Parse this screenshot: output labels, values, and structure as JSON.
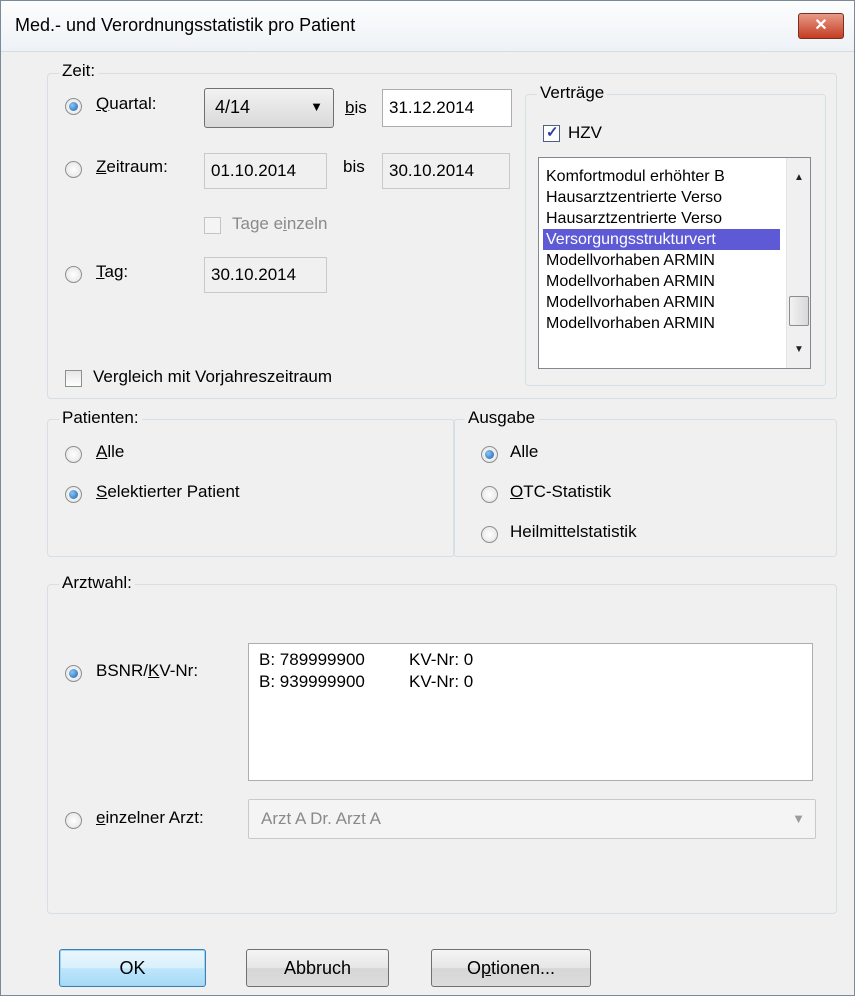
{
  "window": {
    "title": "Med.- und Verordnungsstatistik pro Patient",
    "close_glyph": "✕"
  },
  "zeit": {
    "legend": "Zeit:",
    "quartal": {
      "label": "Quartal:",
      "accel": "Q",
      "label_rest": "uartal:",
      "selected": true,
      "value": "4/14",
      "bis_label_accel": "b",
      "bis_label_rest": "is",
      "bis_value": "31.12.2014"
    },
    "zeitraum": {
      "accel": "Z",
      "label_rest": "eitraum:",
      "selected": false,
      "from": "01.10.2014",
      "bis_label": "bis",
      "to": "30.10.2014"
    },
    "tage_einzeln": {
      "label_pre": "Tage e",
      "accel": "i",
      "label_post": "nzeln",
      "checked": false,
      "enabled": false
    },
    "tag": {
      "accel": "T",
      "label_rest": "ag:",
      "selected": false,
      "value": "30.10.2014"
    },
    "vergleich": {
      "label": "Vergleich mit Vorjahreszeitraum",
      "checked": false
    }
  },
  "vertraege": {
    "legend": "Verträge",
    "hzv": {
      "label": "HZV",
      "checked": true
    },
    "items": [
      "Komfortmodul erhöhter B",
      "Hausarztzentrierte Verso",
      "Hausarztzentrierte Verso",
      "Versorgungsstrukturvert",
      "Modellvorhaben ARMIN",
      "Modellvorhaben ARMIN",
      "Modellvorhaben ARMIN",
      "Modellvorhaben ARMIN"
    ],
    "selected_index": 3
  },
  "patienten": {
    "legend": "Patienten:",
    "alle": {
      "accel": "A",
      "label_rest": "lle",
      "selected": false
    },
    "selektierter": {
      "accel": "S",
      "label_rest": "elektierter Patient",
      "selected": true
    }
  },
  "ausgabe": {
    "legend": "Ausgabe",
    "alle": {
      "label": "Alle",
      "selected": true
    },
    "otc": {
      "accel": "O",
      "label_rest": "TC-Statistik",
      "selected": false
    },
    "heilmittel": {
      "label": "Heilmittelstatistik",
      "selected": false
    }
  },
  "arztwahl": {
    "legend": "Arztwahl:",
    "bsnr": {
      "label_pre": "BSNR/",
      "accel": "K",
      "label_post": "V-Nr:",
      "selected": true
    },
    "entries": [
      {
        "bsnr": "B: 789999900",
        "kv": "KV-Nr: 0"
      },
      {
        "bsnr": "B: 939999900",
        "kv": "KV-Nr: 0"
      }
    ],
    "einzelner": {
      "accel": "e",
      "label_rest": "inzelner Arzt:",
      "selected": false,
      "value": "Arzt A Dr. Arzt A"
    }
  },
  "buttons": {
    "ok": "OK",
    "abbruch": "Abbruch",
    "optionen_pre": "O",
    "optionen_accel": "p",
    "optionen_post": "tionen..."
  }
}
